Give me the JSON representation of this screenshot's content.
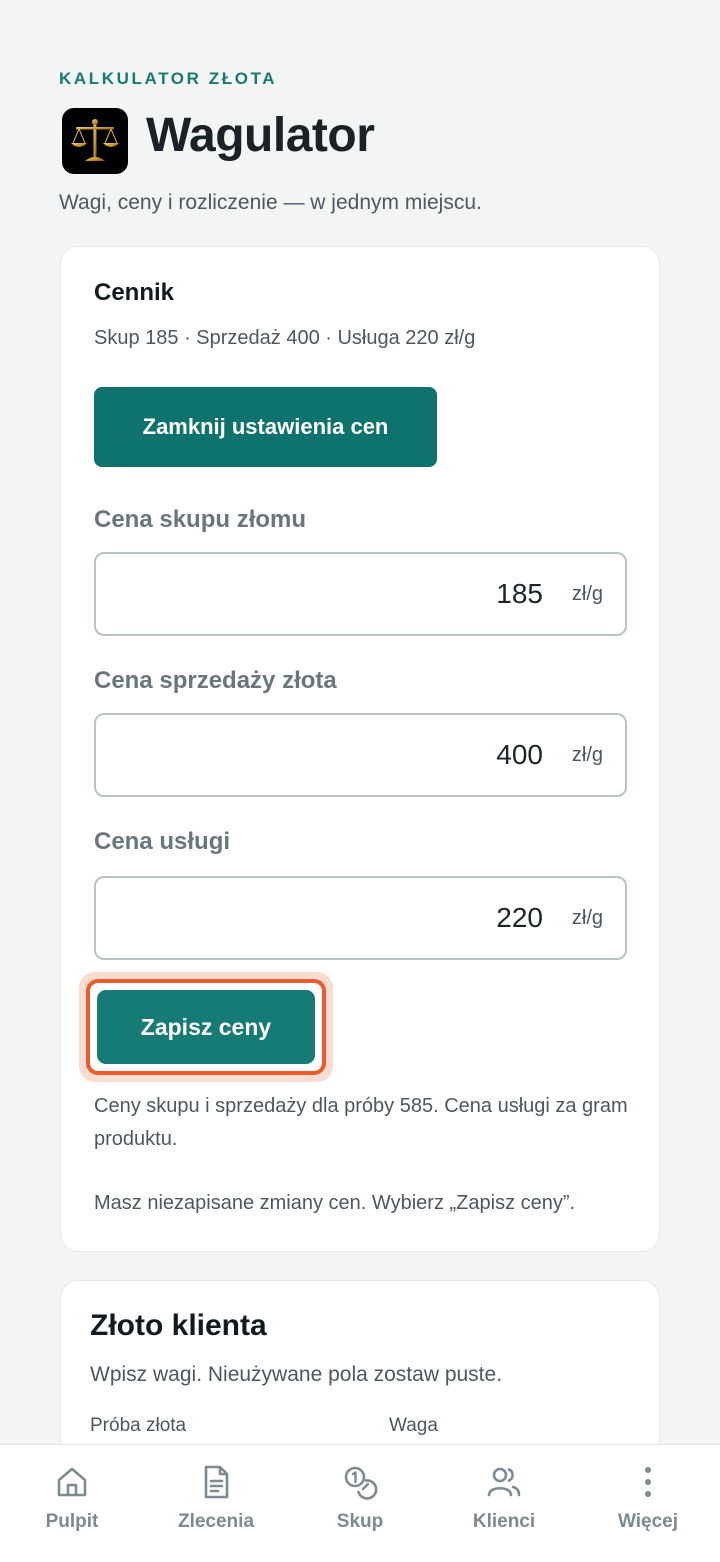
{
  "header": {
    "eyebrow": "KALKULATOR ZŁOTA",
    "app_title": "Wagulator",
    "tagline": "Wagi, ceny i rozliczenie — w jednym miejscu.",
    "app_icon": "balance-scale-icon"
  },
  "pricing": {
    "title": "Cennik",
    "summary": "Skup 185 · Sprzedaż 400 · Usługa 220 zł/g",
    "close_button": "Zamknij ustawienia cen",
    "fields": [
      {
        "label": "Cena skupu złomu",
        "value": "185",
        "unit": "zł/g"
      },
      {
        "label": "Cena sprzedaży złota",
        "value": "400",
        "unit": "zł/g"
      },
      {
        "label": "Cena usługi",
        "value": "220",
        "unit": "zł/g"
      }
    ],
    "save_button": "Zapisz ceny",
    "note": "Ceny skupu i sprzedaży dla próby 585. Cena usługi za gram produktu.",
    "unsaved_warning": "Masz niezapisane zmiany cen. Wybierz „Zapisz ceny”."
  },
  "client_gold": {
    "title": "Złoto klienta",
    "subtitle": "Wpisz wagi. Nieużywane pola zostaw puste.",
    "col_purity": "Próba złota",
    "col_weight": "Waga"
  },
  "nav": {
    "items": [
      {
        "label": "Pulpit",
        "icon": "home-icon"
      },
      {
        "label": "Zlecenia",
        "icon": "document-icon"
      },
      {
        "label": "Skup",
        "icon": "coins-icon"
      },
      {
        "label": "Klienci",
        "icon": "users-icon"
      },
      {
        "label": "Więcej",
        "icon": "more-vertical-icon"
      }
    ]
  },
  "colors": {
    "accent": "#0e736d",
    "highlight": "#ee5a2b",
    "background": "#f3f5f4"
  }
}
